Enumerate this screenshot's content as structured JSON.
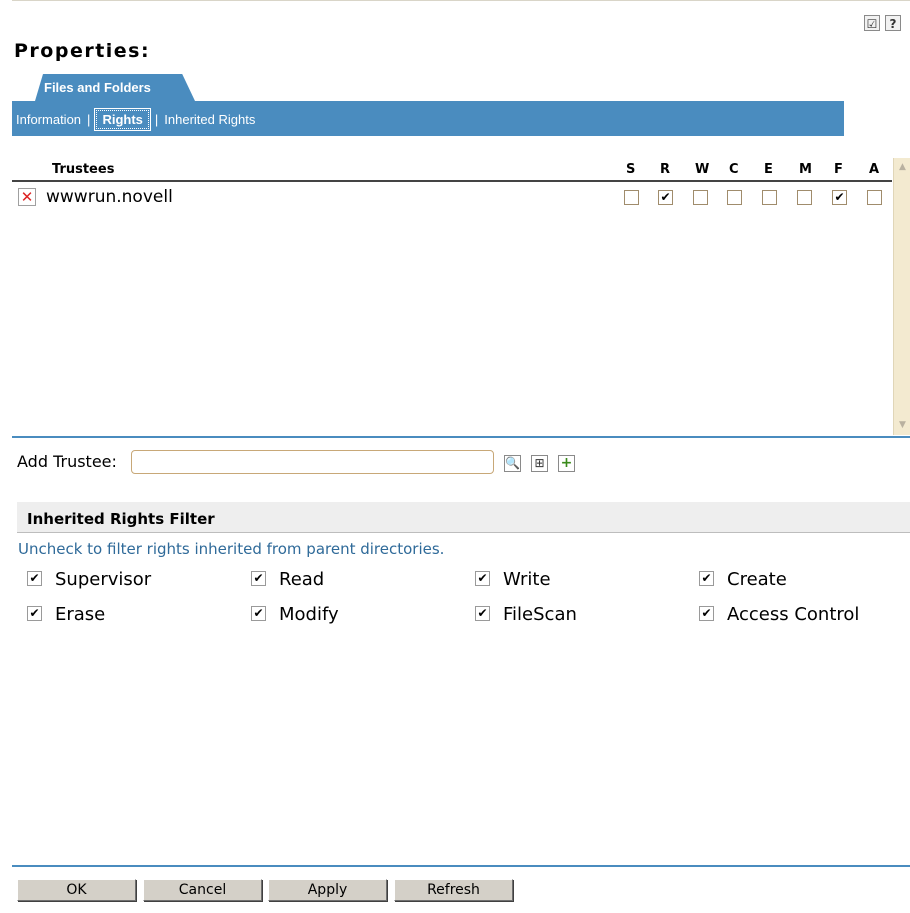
{
  "page_title": "Properties:",
  "header_icons": {
    "checklist": "checklist-icon",
    "help": "?"
  },
  "tab": {
    "label": "Files and Folders"
  },
  "subnav": {
    "items": [
      "Information",
      "Rights",
      "Inherited Rights"
    ],
    "active": "Rights"
  },
  "trustees": {
    "header": "Trustees",
    "columns": [
      "S",
      "R",
      "W",
      "C",
      "E",
      "M",
      "F",
      "A"
    ],
    "rows": [
      {
        "name": "wwwrun.novell",
        "rights": {
          "S": false,
          "R": true,
          "W": false,
          "C": false,
          "E": false,
          "M": false,
          "F": true,
          "A": false
        }
      }
    ]
  },
  "add_trustee": {
    "label": "Add Trustee:",
    "value": "",
    "icons": [
      "search-icon",
      "browse-icon",
      "add-icon"
    ]
  },
  "irf": {
    "title": "Inherited Rights Filter",
    "description": "Uncheck to filter rights inherited from parent directories.",
    "items": [
      {
        "label": "Supervisor",
        "checked": true
      },
      {
        "label": "Read",
        "checked": true
      },
      {
        "label": "Write",
        "checked": true
      },
      {
        "label": "Create",
        "checked": true
      },
      {
        "label": "Erase",
        "checked": true
      },
      {
        "label": "Modify",
        "checked": true
      },
      {
        "label": "FileScan",
        "checked": true
      },
      {
        "label": "Access Control",
        "checked": true
      }
    ]
  },
  "buttons": {
    "ok": "OK",
    "cancel": "Cancel",
    "apply": "Apply",
    "refresh": "Refresh"
  },
  "colors": {
    "accent": "#4a8cbf",
    "scroll_track": "#f3ead0",
    "link_text": "#2f6a99"
  },
  "check_glyph": "✔",
  "delete_glyph": "✕"
}
